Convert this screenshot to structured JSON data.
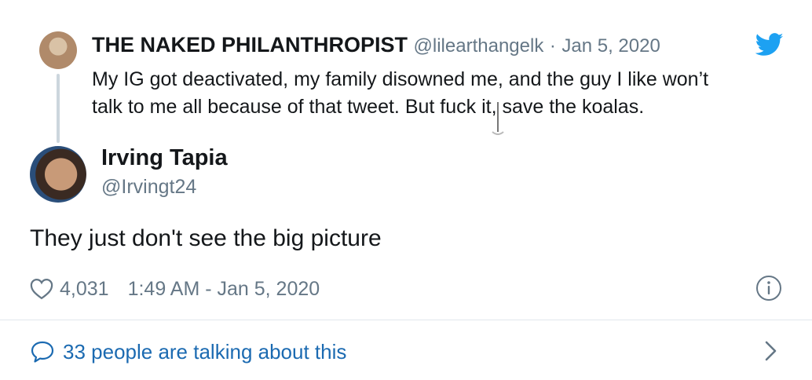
{
  "parent_tweet": {
    "display_name": "THE NAKED PHILANTHROPIST",
    "handle": "@lilearthangelk",
    "separator": "·",
    "date": "Jan 5, 2020",
    "text_line1": "My IG got deactivated, my family disowned me, and the guy I like won’t",
    "text_line2": "talk to me all because of that tweet. But fuck it, save the koalas."
  },
  "tweet": {
    "display_name": "Irving Tapia",
    "handle": "@Irvingt24",
    "text": "They just don't see the big picture",
    "likes": "4,031",
    "timestamp": "1:49 AM - Jan 5, 2020"
  },
  "footer": {
    "talking_label": "33 people are talking about this"
  },
  "icons": {
    "brand": "twitter-bird-icon",
    "like": "heart-icon",
    "info": "info-icon",
    "replies": "speech-bubble-icon",
    "more": "chevron-right-icon"
  },
  "colors": {
    "twitter_blue": "#1da1f2",
    "link_blue": "#1b6ab1",
    "secondary_text": "#657786",
    "primary_text": "#14171a"
  }
}
